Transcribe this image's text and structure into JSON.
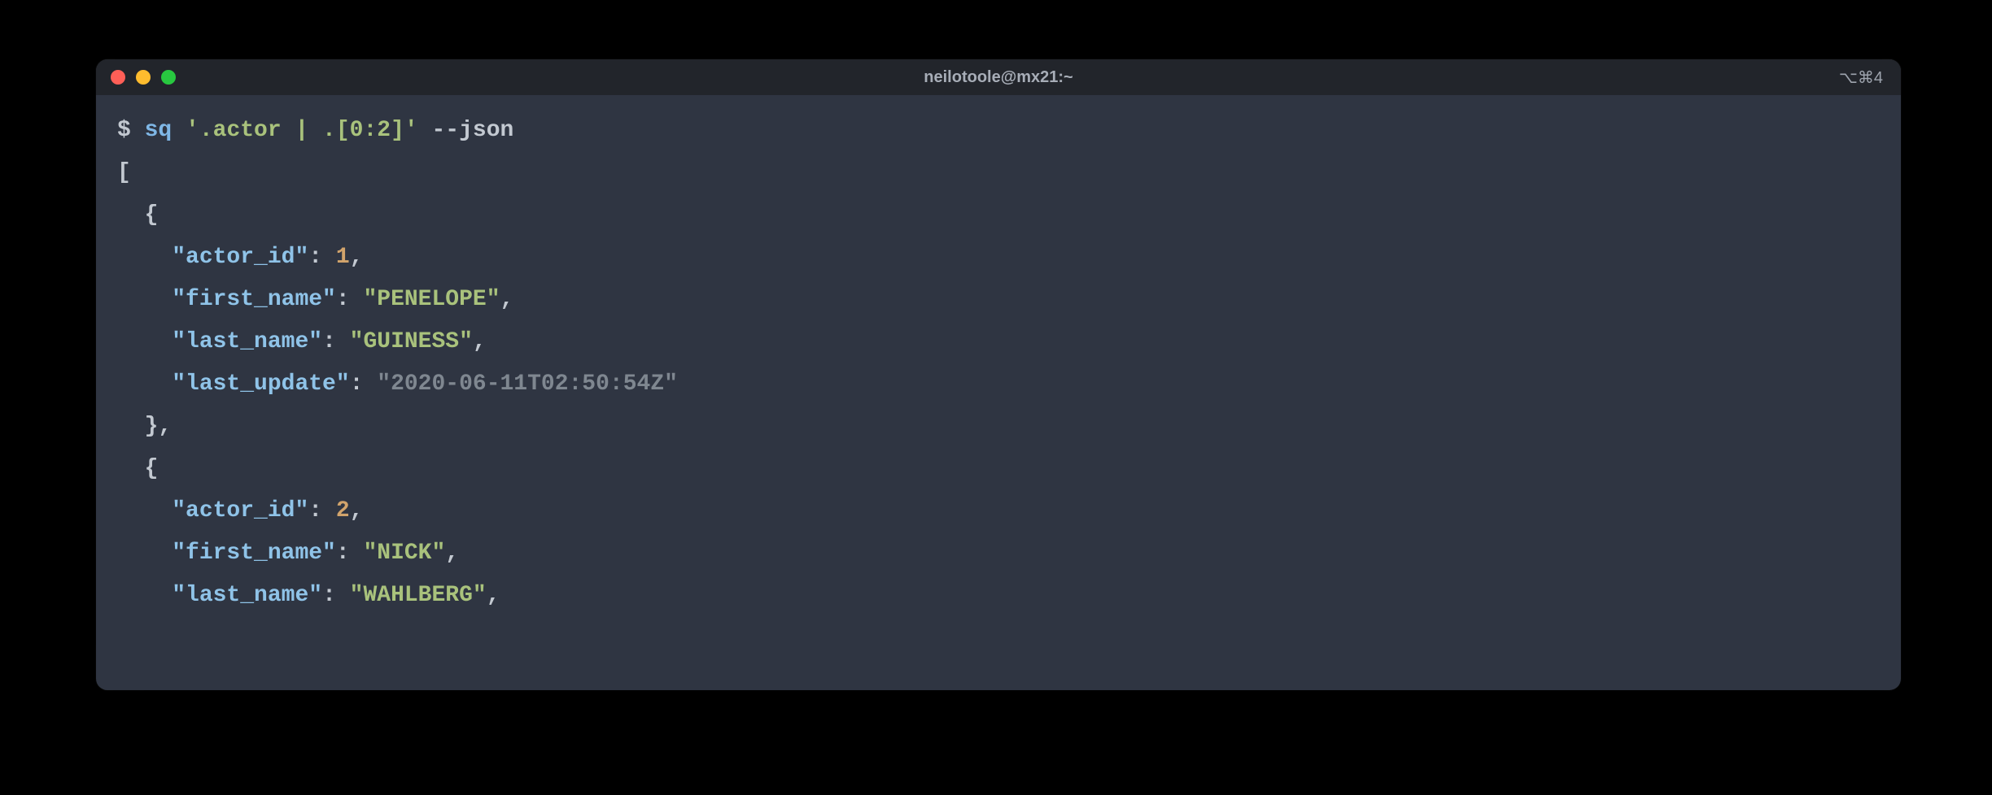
{
  "titlebar": {
    "title": "neilotoole@mx21:~",
    "right": "⌥⌘4"
  },
  "prompt": {
    "symbol": "$",
    "command": "sq",
    "argument": "'.actor | .[0:2]'",
    "flag": "--json"
  },
  "output": {
    "open_bracket": "[",
    "records": [
      {
        "open": "{",
        "fields": [
          {
            "key": "\"actor_id\"",
            "colon": ": ",
            "value": "1",
            "kind": "num",
            "trail": ","
          },
          {
            "key": "\"first_name\"",
            "colon": ": ",
            "value": "\"PENELOPE\"",
            "kind": "str",
            "trail": ","
          },
          {
            "key": "\"last_name\"",
            "colon": ": ",
            "value": "\"GUINESS\"",
            "kind": "str",
            "trail": ","
          },
          {
            "key": "\"last_update\"",
            "colon": ": ",
            "value": "\"2020-06-11T02:50:54Z\"",
            "kind": "dimstr",
            "trail": ""
          }
        ],
        "close": "},"
      },
      {
        "open": "{",
        "fields": [
          {
            "key": "\"actor_id\"",
            "colon": ": ",
            "value": "2",
            "kind": "num",
            "trail": ","
          },
          {
            "key": "\"first_name\"",
            "colon": ": ",
            "value": "\"NICK\"",
            "kind": "str",
            "trail": ","
          },
          {
            "key": "\"last_name\"",
            "colon": ": ",
            "value": "\"WAHLBERG\"",
            "kind": "str",
            "trail": ","
          }
        ],
        "close": ""
      }
    ]
  },
  "indent": {
    "one": "  ",
    "two": "    "
  }
}
